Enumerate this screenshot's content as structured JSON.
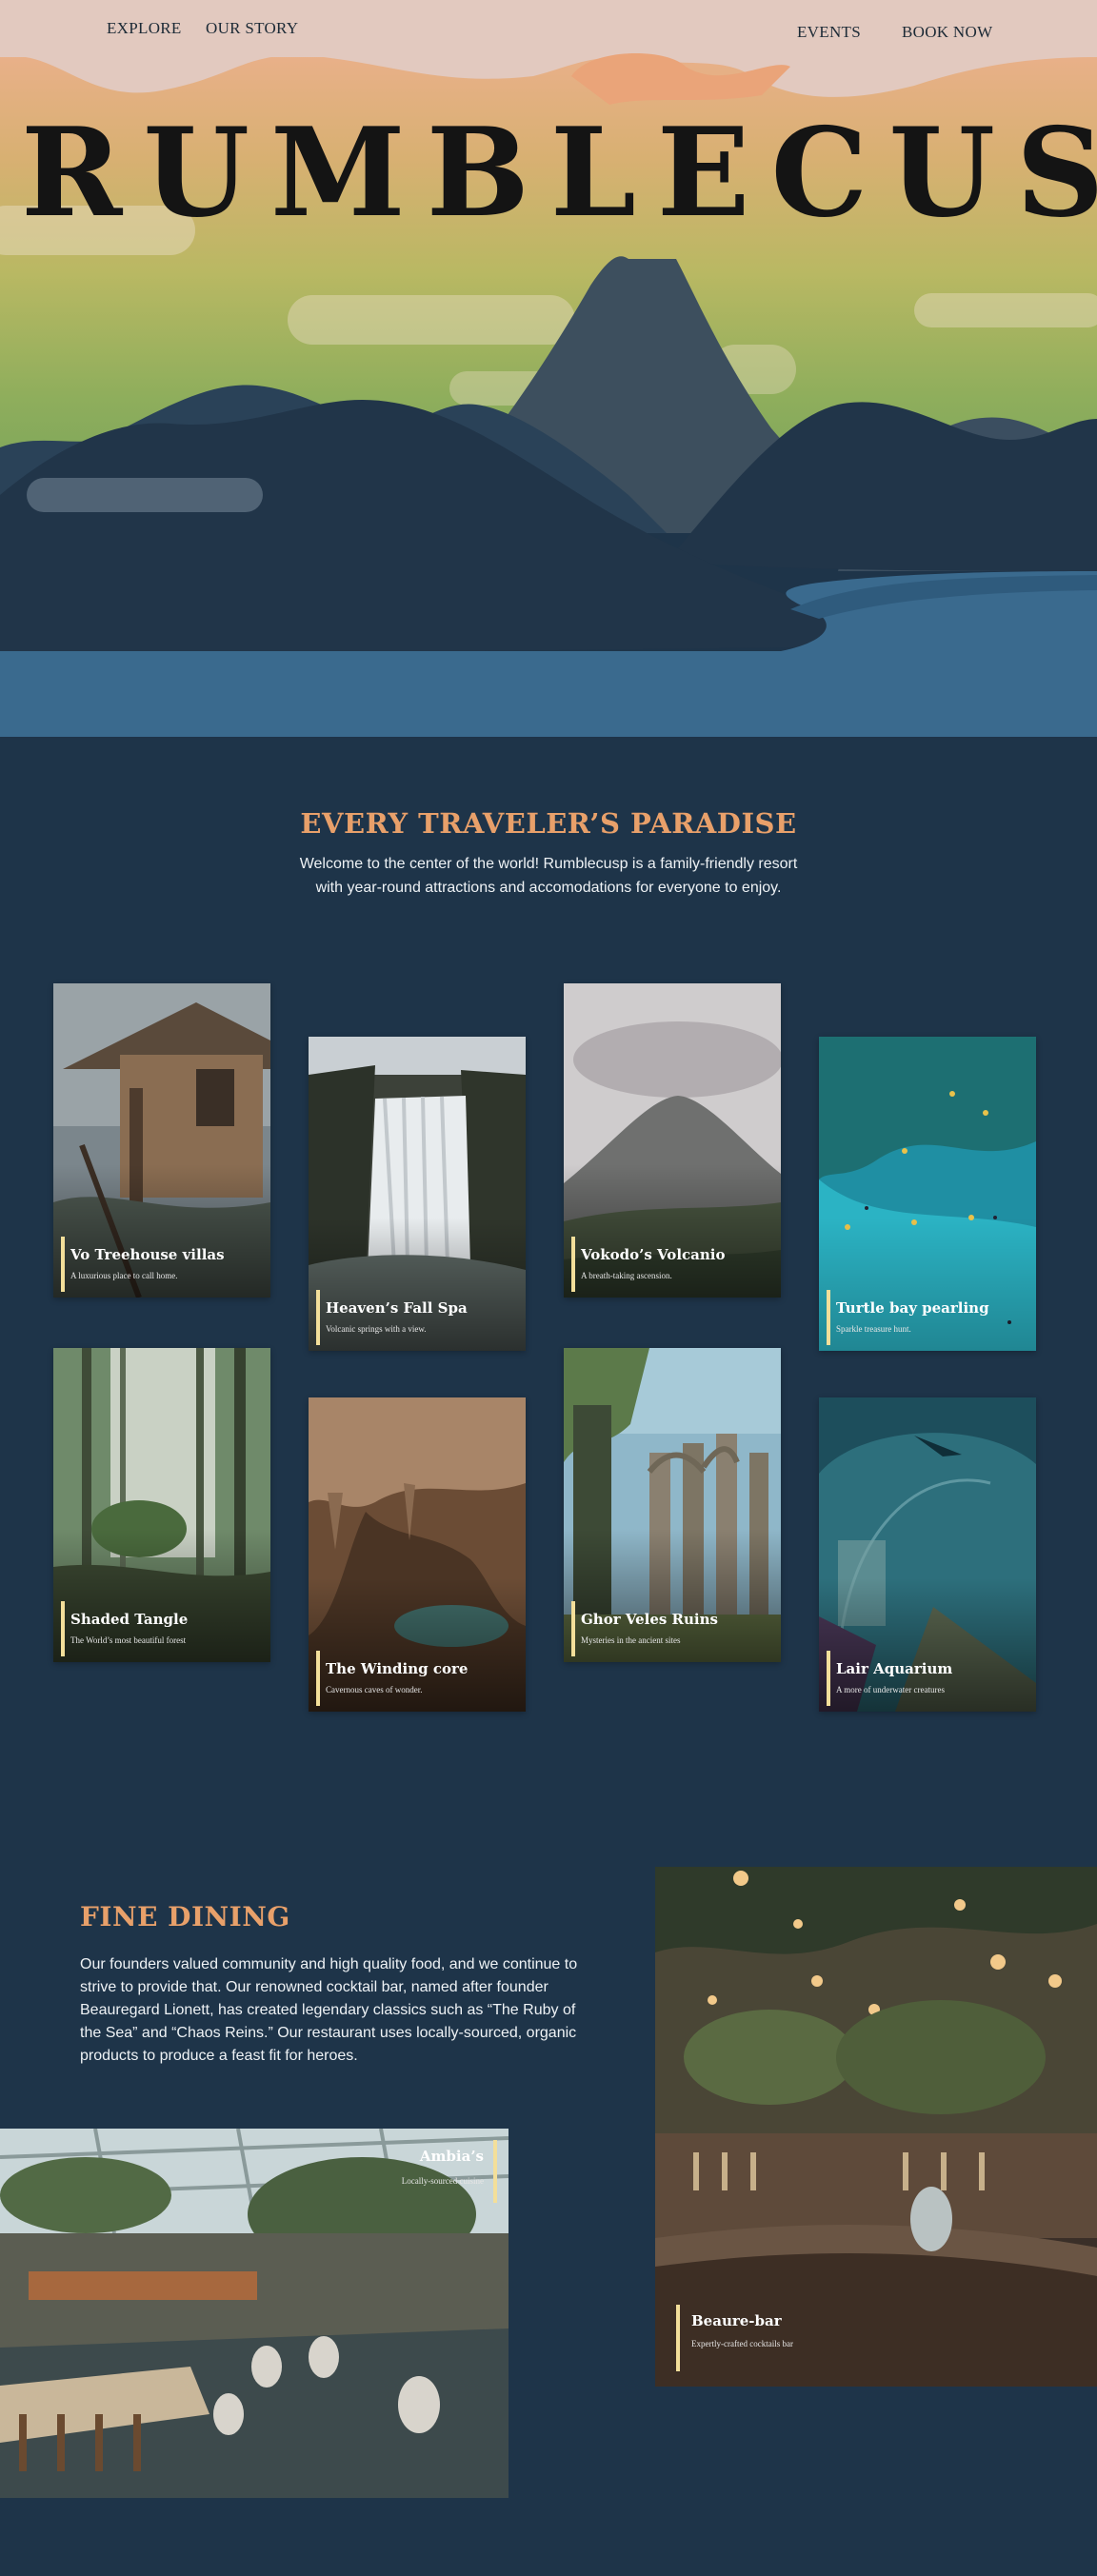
{
  "nav": {
    "explore": "EXPLORE",
    "our_story": "OUR STORY",
    "events": "EVENTS",
    "book_now": "BOOK NOW"
  },
  "hero": {
    "brand": "RUMBLECUSP"
  },
  "paradise": {
    "title": "EVERY TRAVELER’S PARADISE",
    "description": "Welcome to the center of the world! Rumblecusp is a family-friendly resort with year-round attractions and accomodations for everyone to enjoy.",
    "cards": [
      {
        "title": "Vo Treehouse villas",
        "subtitle": "A luxurious place to call home."
      },
      {
        "title": "Heaven’s Fall Spa",
        "subtitle": "Volcanic springs with a view."
      },
      {
        "title": "Vokodo’s Volcanio",
        "subtitle": "A breath-taking ascension."
      },
      {
        "title": "Turtle bay pearling",
        "subtitle": "Sparkle treasure hunt."
      },
      {
        "title": "Shaded Tangle",
        "subtitle": "The World’s most beautiful forest"
      },
      {
        "title": "The Winding core",
        "subtitle": "Cavernous caves of wonder."
      },
      {
        "title": "Ghor Veles Ruins",
        "subtitle": "Mysteries in the ancient sites"
      },
      {
        "title": "Lair Aquarium",
        "subtitle": "A more of underwater creatures"
      }
    ]
  },
  "dining": {
    "title": "FINE DINING",
    "description": "Our founders valued community and high quality food, and we continue to strive to provide that. Our renowned cocktail bar, named after founder Beauregard Lionett, has created legendary classics such as “The Ruby of the Sea” and “Chaos Reins.” Our restaurant uses locally-sourced, organic products to produce a feast fit for heroes.",
    "bar": {
      "title": "Beaure-bar",
      "subtitle": "Expertly-crafted cocktails bar"
    },
    "restaurant": {
      "title": "Ambia’s",
      "subtitle": "Locally-sourced cuisine"
    }
  },
  "colors": {
    "background": "#1e3449",
    "accent": "#e8a06a",
    "card_bar": "#f3df9a"
  }
}
